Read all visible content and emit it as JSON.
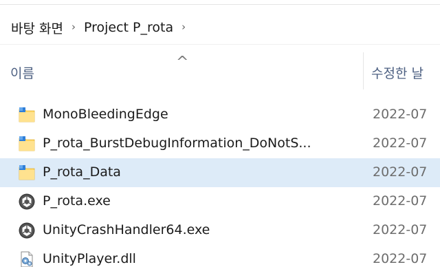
{
  "breadcrumb": {
    "items": [
      "바탕 화면",
      "Project P_rota"
    ],
    "separator": "›"
  },
  "header": {
    "name_label": "이름",
    "date_label": "수정한 날",
    "sort_indicator": "^"
  },
  "files": [
    {
      "name": "MonoBleedingEdge",
      "date": "2022-07",
      "icon": "folder-icon",
      "selected": false
    },
    {
      "name": "P_rota_BurstDebugInformation_DoNotS...",
      "date": "2022-07",
      "icon": "folder-icon",
      "selected": false
    },
    {
      "name": "P_rota_Data",
      "date": "2022-07",
      "icon": "folder-icon",
      "selected": true
    },
    {
      "name": "P_rota.exe",
      "date": "2022-07",
      "icon": "unity-exe-icon",
      "selected": false
    },
    {
      "name": "UnityCrashHandler64.exe",
      "date": "2022-07",
      "icon": "unity-exe-icon",
      "selected": false
    },
    {
      "name": "UnityPlayer.dll",
      "date": "2022-07",
      "icon": "dll-icon",
      "selected": false
    }
  ],
  "colors": {
    "selection": "#ddebf8",
    "folder": "#ffd767",
    "header_text": "#4d6082"
  }
}
